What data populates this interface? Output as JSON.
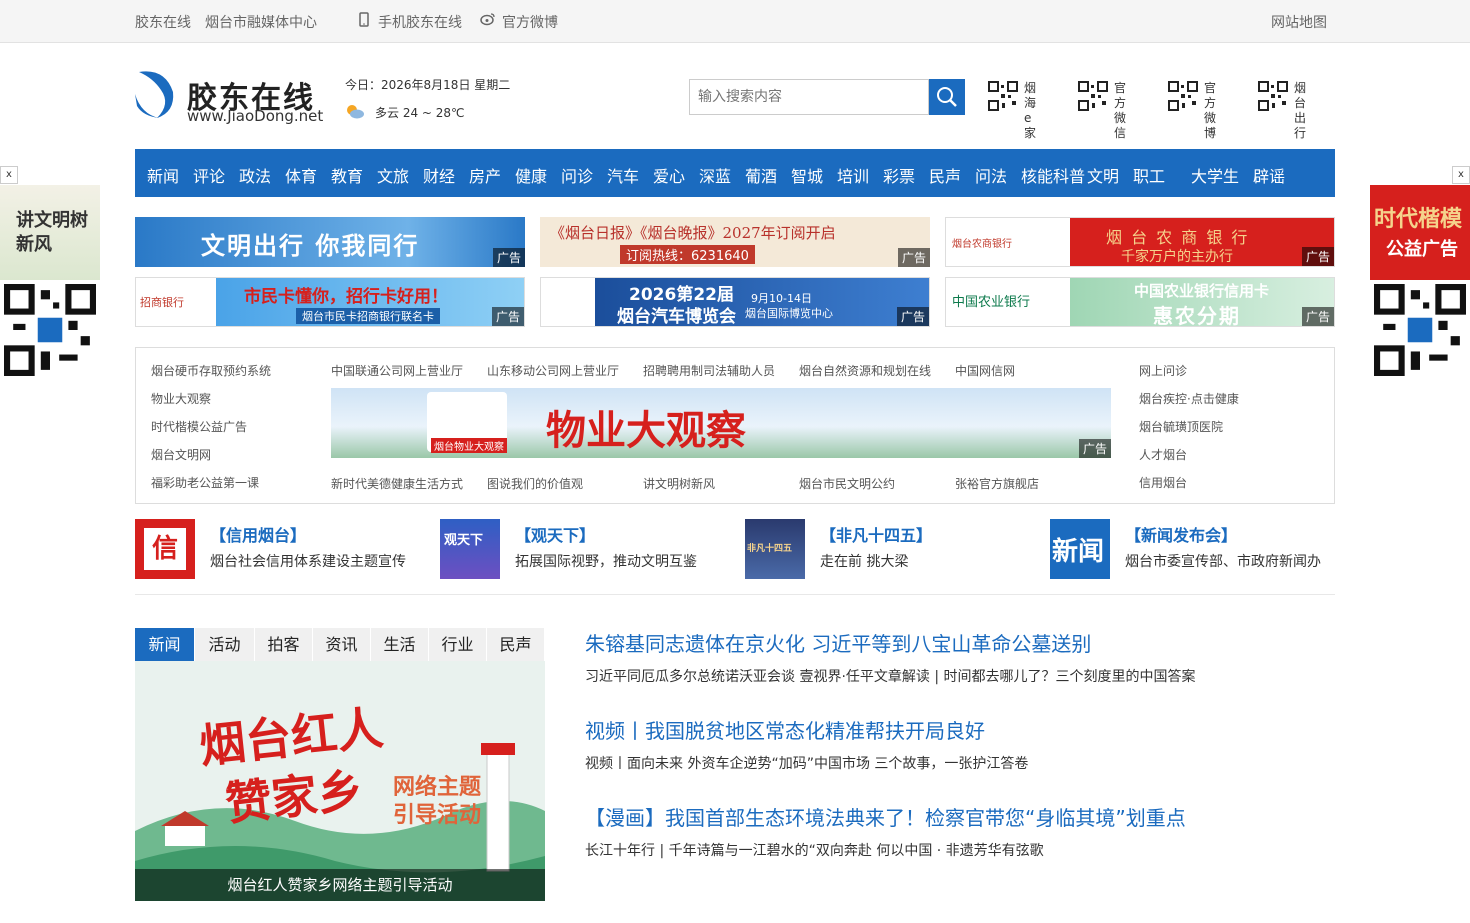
{
  "topbar": {
    "site": "胶东在线",
    "center": "烟台市融媒体中心",
    "mobile": "手机胶东在线",
    "weibo": "官方微博",
    "sitemap": "网站地图"
  },
  "header": {
    "logo_cn": "胶东在线",
    "logo_en": "www.JiaoDong.net",
    "date": "今日：2026年8月18日 星期二",
    "weather": "多云 24 ~ 28℃",
    "search_placeholder": "输入搜索内容",
    "qr": [
      {
        "label": "烟海e家"
      },
      {
        "label": "官方微信"
      },
      {
        "label": "官方微博"
      },
      {
        "label": "烟台出行"
      }
    ]
  },
  "nav": [
    "新闻",
    "评论",
    "政法",
    "体育",
    "教育",
    "文旅",
    "财经",
    "房产",
    "健康",
    "问诊",
    "汽车",
    "爱心",
    "深蓝",
    "葡酒",
    "智城",
    "培训",
    "彩票",
    "民声",
    "问法",
    "核能科普",
    "文明",
    "职工",
    "大学生",
    "辟谣"
  ],
  "ads": {
    "tag": "广告",
    "a1": "文明出行 你我同行",
    "a2": "《烟台日报》《烟台晚报》2027年订阅开启",
    "a2b": "订阅热线：6231640",
    "a3": "烟 台 农 商 银 行",
    "a3b": "千家万户的主办行",
    "a3logo": "烟台农商银行",
    "a4logo": "招商银行",
    "a4": "市民卡懂你，招行卡好用！",
    "a4b": "烟台市民卡招商银行联名卡",
    "a5": "2026第22届",
    "a5b": "烟台汽车博览会",
    "a5c": "9月10-14日",
    "a5d": "烟台国际博览中心",
    "a6logo": "中国农业银行",
    "a6": "中国农业银行信用卡",
    "a6b": "惠农分期",
    "mid": "物业大观察",
    "mid_logo": "烟台物业大观察"
  },
  "links": {
    "col1": [
      "烟台硬币存取预约系统",
      "物业大观察",
      "时代楷模公益广告",
      "烟台文明网",
      "福彩助老公益第一课"
    ],
    "row1": [
      "中国联通公司网上营业厅",
      "山东移动公司网上营业厅",
      "招聘聘用制司法辅助人员",
      "烟台自然资源和规划在线",
      "中国网信网"
    ],
    "row2": [
      "新时代美德健康生活方式",
      "图说我们的价值观",
      "讲文明树新风",
      "烟台市民文明公约",
      "张裕官方旗舰店"
    ],
    "col3": [
      "网上问诊",
      "烟台疾控·点击健康",
      "烟台毓璜顶医院",
      "人才烟台",
      "信用烟台"
    ]
  },
  "features": [
    {
      "title": "【信用烟台】",
      "desc": "烟台社会信用体系建设主题宣传"
    },
    {
      "title": "【观天下】",
      "desc": "拓展国际视野，推动文明互鉴"
    },
    {
      "title": "【非凡十四五】",
      "desc": "走在前 挑大梁"
    },
    {
      "title": "【新闻发布会】",
      "desc": "烟台市委宣传部、市政府新闻办"
    }
  ],
  "feature_img_text": [
    "信",
    "观天下",
    "非凡十四五",
    "新闻"
  ],
  "tabs": [
    "新闻",
    "活动",
    "拍客",
    "资讯",
    "生活",
    "行业",
    "民声"
  ],
  "hero": {
    "art1": "烟台红人",
    "art2": "赞家乡",
    "art3": "网络主题",
    "art4": "引导活动",
    "caption": "烟台红人赞家乡网络主题引导活动"
  },
  "news": [
    {
      "headline": "朱镕基同志遗体在京火化 习近平等到八宝山革命公墓送别",
      "sub": "习近平同厄瓜多尔总统诺沃亚会谈    壹视界·任平文章解读 | 时间都去哪儿了？三个刻度里的中国答案"
    },
    {
      "headline": "视频丨我国脱贫地区常态化精准帮扶开局良好",
      "sub": "视频丨面向未来 外资车企逆势“加码”中国市场    三个故事，一张护江答卷"
    },
    {
      "headline": "【漫画】我国首部生态环境法典来了！检察官带您“身临其境”划重点",
      "sub": "长江十年行 | 千年诗篇与一江碧水的“双向奔赴    何以中国 · 非遗芳华有弦歌"
    }
  ],
  "side": {
    "left_text": "讲文明树新风",
    "right_text1": "时代楷模",
    "right_text2": "公益广告",
    "close": "x"
  },
  "colors": {
    "brand": "#1b6bbf"
  }
}
